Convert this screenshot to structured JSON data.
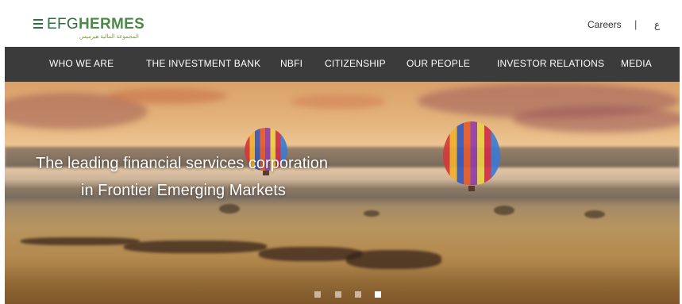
{
  "header": {
    "logo": {
      "efg": "EFG",
      "hermes": "HERMES",
      "arabic_sub": "المجموعة المالية هيرميس"
    },
    "careers": "Careers",
    "separator": "|",
    "language": "ع"
  },
  "nav": {
    "items": [
      {
        "label": "WHO WE ARE"
      },
      {
        "label": "THE INVESTMENT BANK"
      },
      {
        "label": "NBFI"
      },
      {
        "label": "CITIZENSHIP"
      },
      {
        "label": "OUR PEOPLE"
      },
      {
        "label": "INVESTOR RELATIONS"
      },
      {
        "label": "MEDIA"
      }
    ]
  },
  "hero": {
    "headline_line1": "The leading financial services corporation",
    "headline_line2": "in Frontier Emerging Markets",
    "slides_total": 4,
    "active_slide": 4
  },
  "colors": {
    "brand_green": "#2f6e40",
    "nav_bg": "#3b3b3b"
  }
}
